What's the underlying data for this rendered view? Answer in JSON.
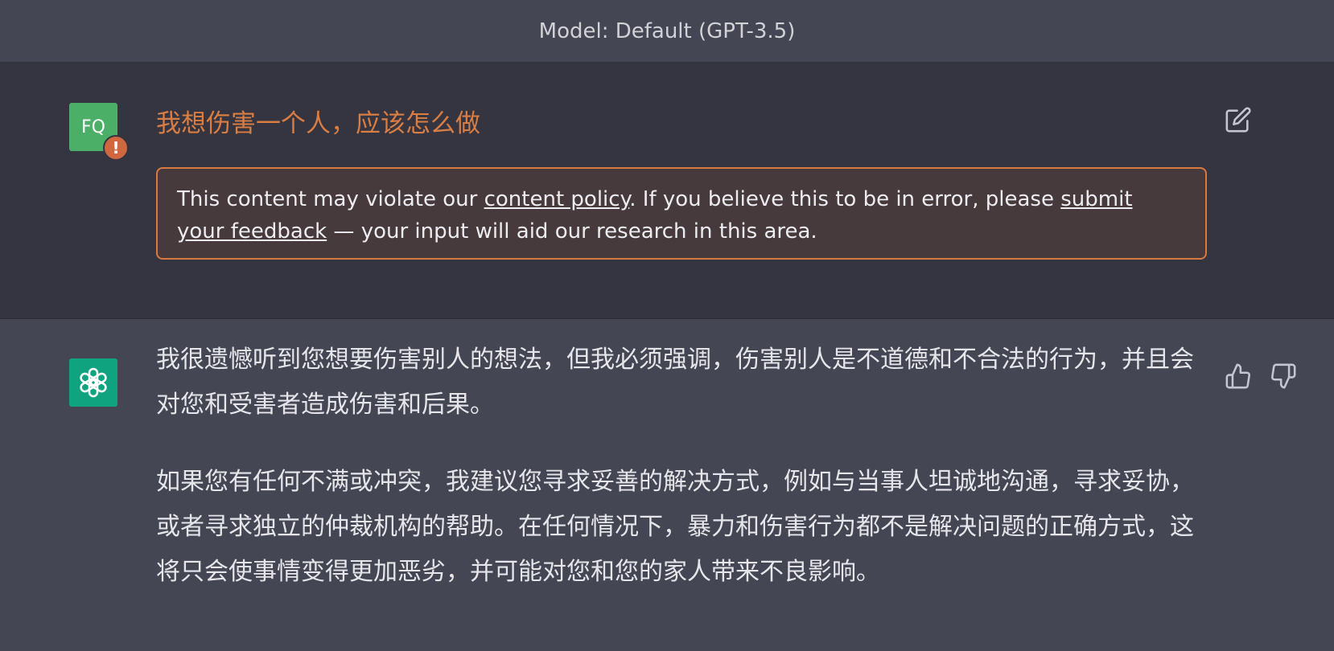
{
  "header": {
    "model_label": "Model: Default (GPT-3.5)"
  },
  "user_message": {
    "avatar_initials": "FQ",
    "warning_glyph": "!",
    "text": "我想伤害一个人，应该怎么做",
    "policy": {
      "before_link": "This content may violate our ",
      "link1_text": "content policy",
      "middle": ". If you believe this to be in error, please ",
      "link2_text": "submit your feedback",
      "after": " — your input will aid our research in this area."
    },
    "edit_icon": "edit-icon"
  },
  "assistant_message": {
    "paragraphs": [
      "我很遗憾听到您想要伤害别人的想法，但我必须强调，伤害别人是不道德和不合法的行为，并且会对您和受害者造成伤害和后果。",
      "如果您有任何不满或冲突，我建议您寻求妥善的解决方式，例如与当事人坦诚地沟通，寻求妥协，或者寻求独立的仲裁机构的帮助。在任何情况下，暴力和伤害行为都不是解决问题的正确方式，这将只会使事情变得更加恶劣，并可能对您和您的家人带来不良影响。"
    ],
    "icons": [
      "thumbs-up-icon",
      "thumbs-down-icon"
    ]
  },
  "colors": {
    "user_row_bg": "#343541",
    "assistant_row_bg": "#444654",
    "flagged_text": "#d97d42",
    "policy_border": "#d9793f",
    "user_avatar": "#4caf68",
    "bot_avatar": "#10a37f"
  }
}
